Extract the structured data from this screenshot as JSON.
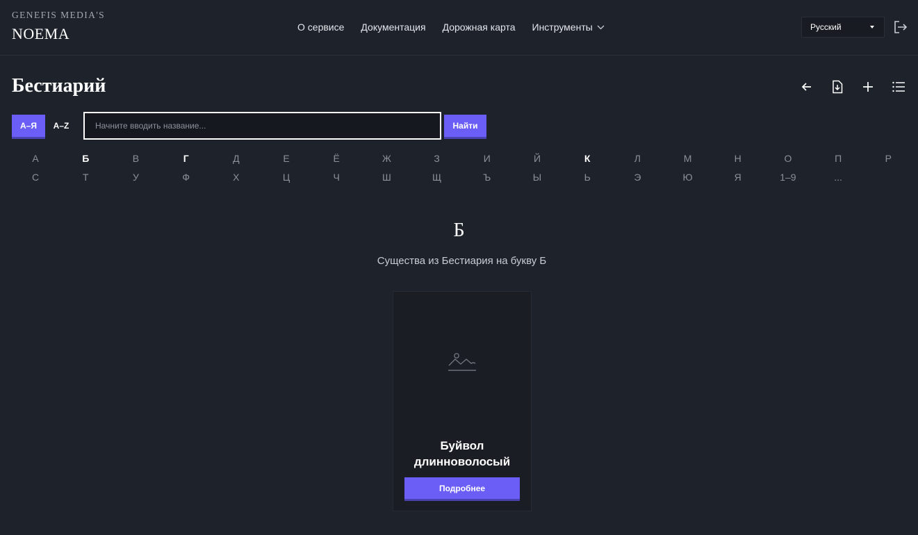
{
  "brand": {
    "top": "GENEFIS MEDIA'S",
    "main": "NOEMA"
  },
  "nav": [
    {
      "label": "О сервисе"
    },
    {
      "label": "Документация"
    },
    {
      "label": "Дорожная карта"
    },
    {
      "label": "Инструменты"
    }
  ],
  "lang": {
    "selected": "Русский"
  },
  "page": {
    "title": "Бестиарий"
  },
  "search": {
    "btn_ru": "А–Я",
    "btn_en": "A–Z",
    "placeholder": "Начните вводить название...",
    "value": "",
    "find_label": "Найти"
  },
  "alphabet": {
    "row1": [
      "А",
      "Б",
      "В",
      "Г",
      "Д",
      "Е",
      "Ё",
      "Ж",
      "З",
      "И",
      "Й",
      "К",
      "Л",
      "М",
      "Н",
      "О",
      "П",
      "Р"
    ],
    "row2": [
      "С",
      "Т",
      "У",
      "Ф",
      "Х",
      "Ц",
      "Ч",
      "Ш",
      "Щ",
      "Ъ",
      "Ы",
      "Ь",
      "Э",
      "Ю",
      "Я",
      "1–9",
      "..."
    ],
    "active": [
      "Б",
      "Г",
      "К"
    ]
  },
  "section": {
    "letter": "Б",
    "subtitle": "Существа из Бестиария на букву Б"
  },
  "cards": [
    {
      "title": "Буйвол длинноволосый",
      "button": "Подробнее"
    }
  ]
}
